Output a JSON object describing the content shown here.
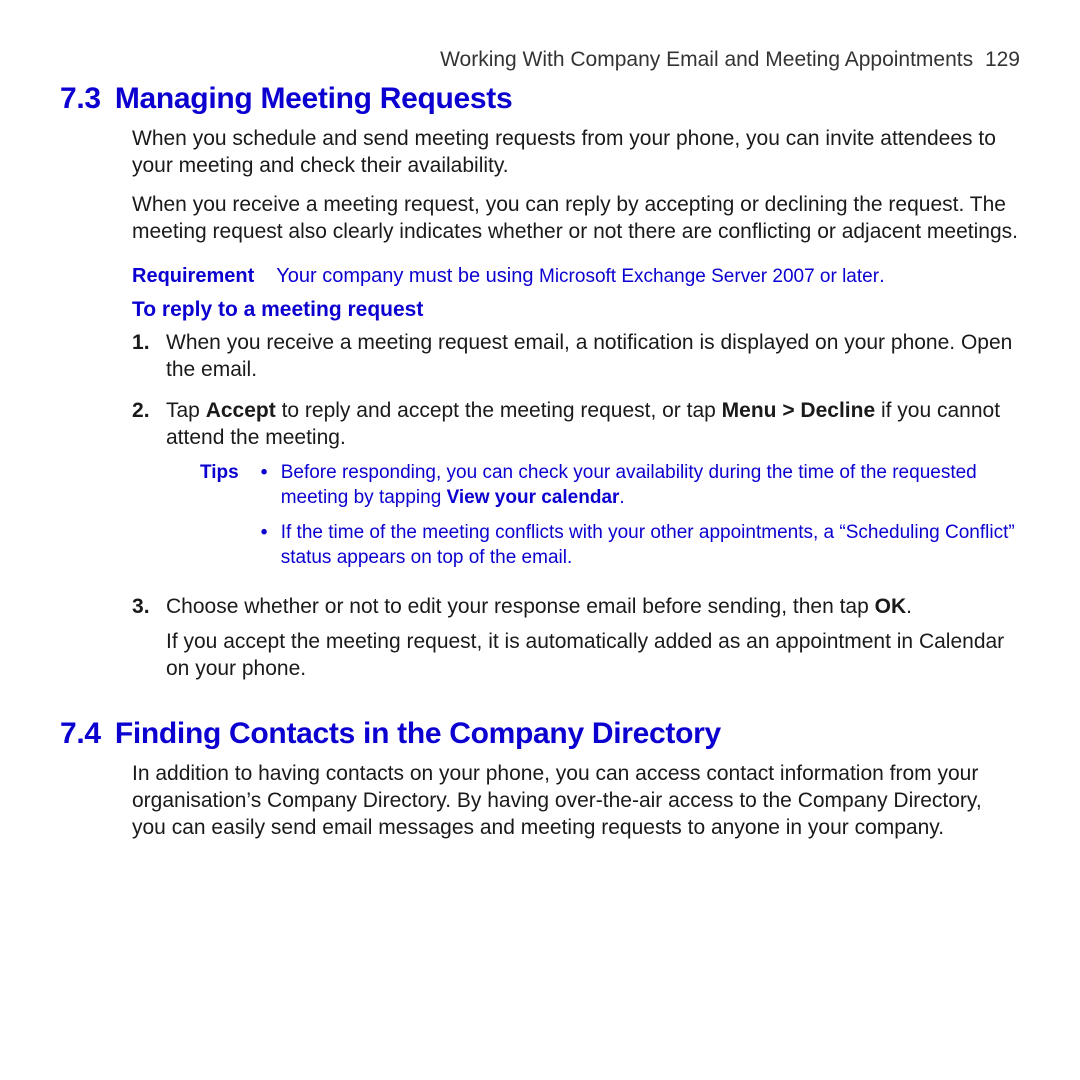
{
  "header": {
    "chapter_title": "Working With Company Email and Meeting Appointments",
    "page_number": "129"
  },
  "section_7_3": {
    "number": "7.3",
    "title": "Managing Meeting Requests",
    "para1": "When you schedule and send meeting requests from your phone, you can invite attendees to your meeting and check their availability.",
    "para2": "When you receive a meeting request, you can reply by accepting or declining the request. The meeting request also clearly indicates whether or not there are conflicting or adjacent meetings.",
    "requirement": {
      "label": "Requirement",
      "text_prefix": "Your company must be using ",
      "text_suffix": "Microsoft Exchange Server 2007 or later",
      "text_period": "."
    },
    "subheading": "To reply to a meeting request",
    "step1": "When you receive a meeting request email, a notification is displayed on your phone. Open the email.",
    "step2": {
      "t1": "Tap ",
      "b1": "Accept",
      "t2": " to reply and accept the meeting request, or tap ",
      "b2": "Menu > Decline",
      "t3": " if you cannot attend the meeting."
    },
    "tips": {
      "label": "Tips",
      "tip1": {
        "t1": "Before responding, you can check your availability during the time of the requested meeting by tapping ",
        "b1": "View your calendar",
        "t2": "."
      },
      "tip2": "If the time of the meeting conflicts with your other appointments, a “Scheduling Conflict” status appears on top of the email."
    },
    "step3": {
      "t1": "Choose whether or not to edit your response email before sending, then tap ",
      "b1": "OK",
      "t2": "."
    },
    "step3_follow": "If you accept the meeting request, it is automatically added as an appointment in Calendar on your phone."
  },
  "section_7_4": {
    "number": "7.4",
    "title": "Finding Contacts in the Company Directory",
    "para1": "In addition to having contacts on your phone, you can access contact information from your organisation’s Company Directory. By having over-the-air access to the Company Directory, you can easily send email messages and meeting requests to anyone in your company."
  }
}
